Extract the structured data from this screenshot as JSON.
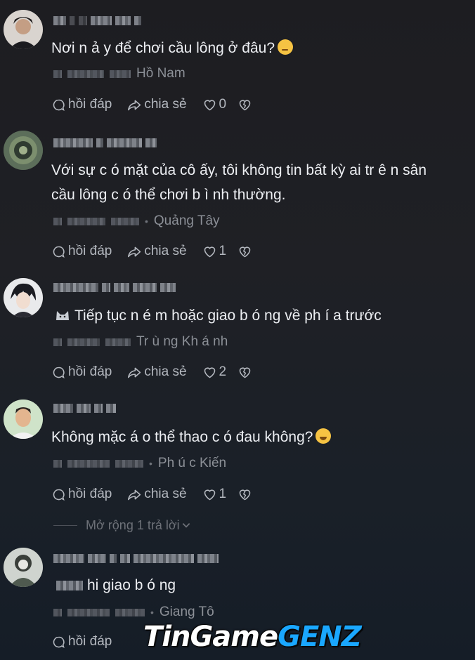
{
  "comments": [
    {
      "text": "Nơi n ả y để chơi cầu lông ở đâu?",
      "location": "Hồ Nam",
      "reply_label": "hồi đáp",
      "share_label": "chia sẻ",
      "likes": "0"
    },
    {
      "text_line1": "Với sự c ó  mặt của cô ấy, tôi không tin bất kỳ ai tr ê n sân",
      "text_line2": "cầu lông c ó  thể chơi b ì nh thường.",
      "location": "Quảng Tây",
      "reply_label": "hồi đáp",
      "share_label": "chia sẻ",
      "likes": "1"
    },
    {
      "text": "Tiếp tục n é m hoặc giao b ó ng về ph í a trước",
      "location": "Tr ù ng Kh á nh",
      "reply_label": "hồi đáp",
      "share_label": "chia sẻ",
      "likes": "2"
    },
    {
      "text": "Không mặc  á o thể thao c ó  đau không?",
      "location": "Ph ú c Kiến",
      "reply_label": "hồi đáp",
      "share_label": "chia sẻ",
      "likes": "1",
      "expand_label": "Mở rộng 1 trả lời"
    },
    {
      "text": "hi giao b ó ng",
      "location": "Giang Tô",
      "reply_label": "hồi đáp"
    }
  ],
  "watermark": {
    "part1": "TinGame",
    "part2": "GENZ"
  },
  "colors": {
    "background": "#1d1f24",
    "text": "#eceef2",
    "meta": "#8c9097",
    "watermark_accent": "#1aa7ff"
  },
  "icons": [
    "reply-icon",
    "share-icon",
    "heart-icon",
    "broken-heart-icon"
  ]
}
